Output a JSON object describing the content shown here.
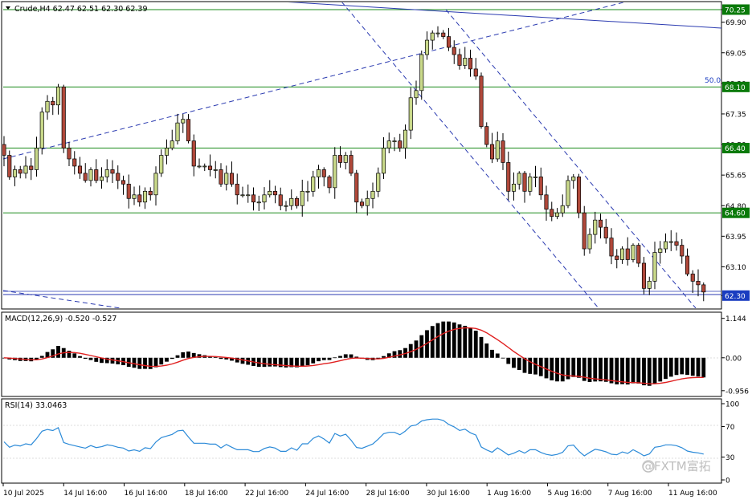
{
  "header": {
    "main_label": "Crude,H4  62.47 62.51 62.30 62.39",
    "macd_label": "MACD(12,26,9) -0.520 -0.527",
    "rsi_label": "RSI(14) 33.0463"
  },
  "watermark": "@FXTM富拓",
  "fib_label": "50.0",
  "colors": {
    "bull": "#c9d98a",
    "bear": "#b0483a",
    "hline": "#1a8a1a",
    "trendline": "#2a3ab0",
    "signal": "#e02020",
    "rsi": "#2b8ad8",
    "price_tag": "#1a3cc0",
    "green_tag": "#0a7a0a"
  },
  "chart_data": [
    {
      "type": "candlestick",
      "symbol": "Crude",
      "timeframe": "H4",
      "ylim": [
        61.95,
        70.45
      ],
      "yticks": [
        "70.25",
        "69.90",
        "69.05",
        "68.20",
        "67.35",
        "66.50",
        "65.65",
        "64.80",
        "63.95",
        "63.10",
        "62.30"
      ],
      "hlines": [
        {
          "value": 70.25,
          "label": "70.25"
        },
        {
          "value": 68.1,
          "label": "68.10"
        },
        {
          "value": 66.4,
          "label": "66.40"
        },
        {
          "value": 64.6,
          "label": "64.60"
        }
      ],
      "current_price": {
        "value": 62.3,
        "label": "62.30"
      },
      "xticks": [
        "10 Jul 2025",
        "14 Jul 16:00",
        "16 Jul 16:00",
        "18 Jul 16:00",
        "22 Jul 16:00",
        "24 Jul 16:00",
        "28 Jul 16:00",
        "30 Jul 16:00",
        "1 Aug 16:00",
        "5 Aug 16:00",
        "7 Aug 16:00",
        "11 Aug 16:00"
      ],
      "closes": [
        66.2,
        65.6,
        65.8,
        65.7,
        65.9,
        65.8,
        66.4,
        67.4,
        67.7,
        67.6,
        68.1,
        66.4,
        66.1,
        65.9,
        65.7,
        65.5,
        65.8,
        65.5,
        65.6,
        65.8,
        65.7,
        65.5,
        65.4,
        65.0,
        65.1,
        64.9,
        65.2,
        65.1,
        65.7,
        66.2,
        66.4,
        66.6,
        67.1,
        67.2,
        66.6,
        65.9,
        65.9,
        65.9,
        65.8,
        65.8,
        65.4,
        65.7,
        65.4,
        65.1,
        65.1,
        65.1,
        64.9,
        64.9,
        65.1,
        65.2,
        65.1,
        64.8,
        64.8,
        65.0,
        64.8,
        65.2,
        65.2,
        65.6,
        65.8,
        65.6,
        65.3,
        66.2,
        66.0,
        66.2,
        65.7,
        64.9,
        64.8,
        65.0,
        65.2,
        65.7,
        66.4,
        66.6,
        66.6,
        66.4,
        66.9,
        67.8,
        68.0,
        69.0,
        69.4,
        69.6,
        69.6,
        69.5,
        69.2,
        69.0,
        68.7,
        68.9,
        68.6,
        68.4,
        67.0,
        66.5,
        66.1,
        66.6,
        66.0,
        65.2,
        65.4,
        65.7,
        65.2,
        65.6,
        65.6,
        65.1,
        64.7,
        64.5,
        64.6,
        64.8,
        65.5,
        65.6,
        64.6,
        63.6,
        64.0,
        64.4,
        64.2,
        63.9,
        63.4,
        63.3,
        63.6,
        63.3,
        63.7,
        63.2,
        62.5,
        62.7,
        63.5,
        63.6,
        63.8,
        63.8,
        63.7,
        63.4,
        62.9,
        62.7,
        62.6,
        62.4
      ]
    },
    {
      "type": "bar",
      "name": "MACD(12,26,9)",
      "title": "MACD(12,26,9) -0.520 -0.527",
      "ylim": [
        -1.1,
        1.3
      ],
      "yticks": [
        "1.144",
        "0.00",
        "-0.956"
      ],
      "last_values": [
        -0.52,
        -0.527
      ]
    },
    {
      "type": "line",
      "name": "RSI(14)",
      "title": "RSI(14) 33.0463",
      "ylim": [
        0,
        100
      ],
      "yticks": [
        "100",
        "70",
        "30",
        "0"
      ],
      "last_value": 33.0463
    }
  ]
}
